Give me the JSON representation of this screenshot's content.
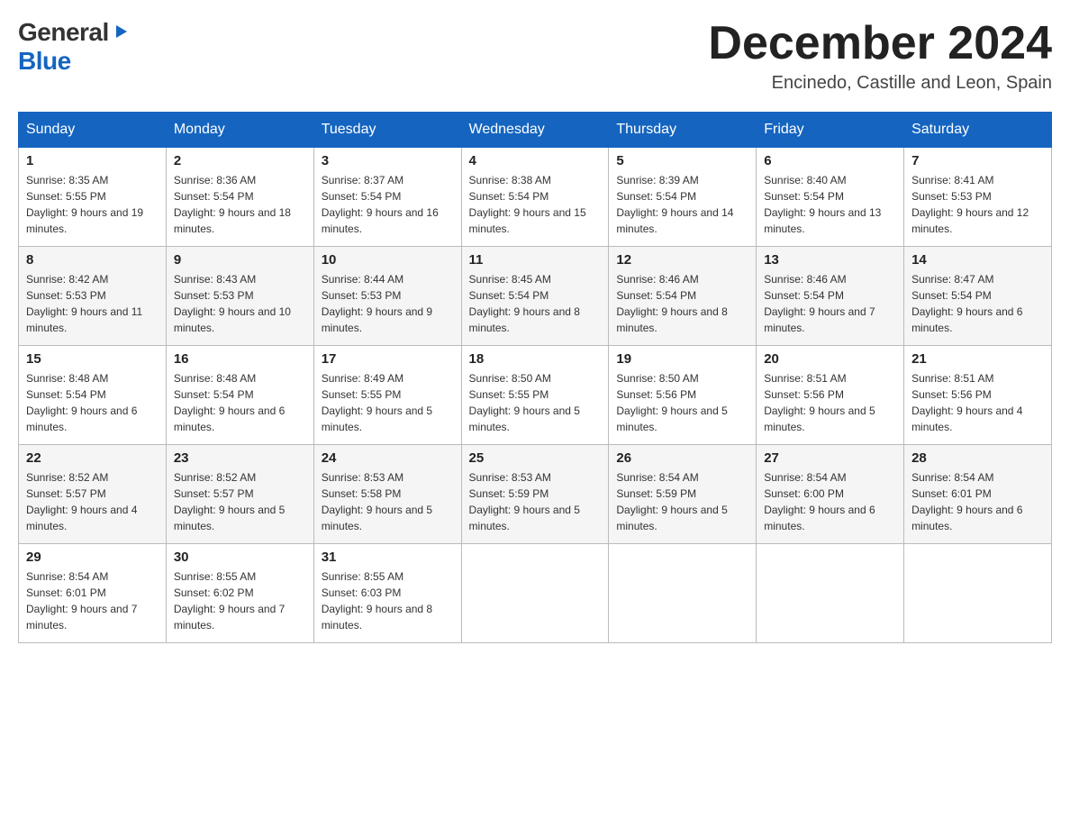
{
  "logo": {
    "general": "General",
    "blue": "Blue",
    "arrow": "▶"
  },
  "header": {
    "month_year": "December 2024",
    "location": "Encinedo, Castille and Leon, Spain"
  },
  "weekdays": [
    "Sunday",
    "Monday",
    "Tuesday",
    "Wednesday",
    "Thursday",
    "Friday",
    "Saturday"
  ],
  "weeks": [
    [
      {
        "day": "1",
        "sunrise": "8:35 AM",
        "sunset": "5:55 PM",
        "daylight": "9 hours and 19 minutes."
      },
      {
        "day": "2",
        "sunrise": "8:36 AM",
        "sunset": "5:54 PM",
        "daylight": "9 hours and 18 minutes."
      },
      {
        "day": "3",
        "sunrise": "8:37 AM",
        "sunset": "5:54 PM",
        "daylight": "9 hours and 16 minutes."
      },
      {
        "day": "4",
        "sunrise": "8:38 AM",
        "sunset": "5:54 PM",
        "daylight": "9 hours and 15 minutes."
      },
      {
        "day": "5",
        "sunrise": "8:39 AM",
        "sunset": "5:54 PM",
        "daylight": "9 hours and 14 minutes."
      },
      {
        "day": "6",
        "sunrise": "8:40 AM",
        "sunset": "5:54 PM",
        "daylight": "9 hours and 13 minutes."
      },
      {
        "day": "7",
        "sunrise": "8:41 AM",
        "sunset": "5:53 PM",
        "daylight": "9 hours and 12 minutes."
      }
    ],
    [
      {
        "day": "8",
        "sunrise": "8:42 AM",
        "sunset": "5:53 PM",
        "daylight": "9 hours and 11 minutes."
      },
      {
        "day": "9",
        "sunrise": "8:43 AM",
        "sunset": "5:53 PM",
        "daylight": "9 hours and 10 minutes."
      },
      {
        "day": "10",
        "sunrise": "8:44 AM",
        "sunset": "5:53 PM",
        "daylight": "9 hours and 9 minutes."
      },
      {
        "day": "11",
        "sunrise": "8:45 AM",
        "sunset": "5:54 PM",
        "daylight": "9 hours and 8 minutes."
      },
      {
        "day": "12",
        "sunrise": "8:46 AM",
        "sunset": "5:54 PM",
        "daylight": "9 hours and 8 minutes."
      },
      {
        "day": "13",
        "sunrise": "8:46 AM",
        "sunset": "5:54 PM",
        "daylight": "9 hours and 7 minutes."
      },
      {
        "day": "14",
        "sunrise": "8:47 AM",
        "sunset": "5:54 PM",
        "daylight": "9 hours and 6 minutes."
      }
    ],
    [
      {
        "day": "15",
        "sunrise": "8:48 AM",
        "sunset": "5:54 PM",
        "daylight": "9 hours and 6 minutes."
      },
      {
        "day": "16",
        "sunrise": "8:48 AM",
        "sunset": "5:54 PM",
        "daylight": "9 hours and 6 minutes."
      },
      {
        "day": "17",
        "sunrise": "8:49 AM",
        "sunset": "5:55 PM",
        "daylight": "9 hours and 5 minutes."
      },
      {
        "day": "18",
        "sunrise": "8:50 AM",
        "sunset": "5:55 PM",
        "daylight": "9 hours and 5 minutes."
      },
      {
        "day": "19",
        "sunrise": "8:50 AM",
        "sunset": "5:56 PM",
        "daylight": "9 hours and 5 minutes."
      },
      {
        "day": "20",
        "sunrise": "8:51 AM",
        "sunset": "5:56 PM",
        "daylight": "9 hours and 5 minutes."
      },
      {
        "day": "21",
        "sunrise": "8:51 AM",
        "sunset": "5:56 PM",
        "daylight": "9 hours and 4 minutes."
      }
    ],
    [
      {
        "day": "22",
        "sunrise": "8:52 AM",
        "sunset": "5:57 PM",
        "daylight": "9 hours and 4 minutes."
      },
      {
        "day": "23",
        "sunrise": "8:52 AM",
        "sunset": "5:57 PM",
        "daylight": "9 hours and 5 minutes."
      },
      {
        "day": "24",
        "sunrise": "8:53 AM",
        "sunset": "5:58 PM",
        "daylight": "9 hours and 5 minutes."
      },
      {
        "day": "25",
        "sunrise": "8:53 AM",
        "sunset": "5:59 PM",
        "daylight": "9 hours and 5 minutes."
      },
      {
        "day": "26",
        "sunrise": "8:54 AM",
        "sunset": "5:59 PM",
        "daylight": "9 hours and 5 minutes."
      },
      {
        "day": "27",
        "sunrise": "8:54 AM",
        "sunset": "6:00 PM",
        "daylight": "9 hours and 6 minutes."
      },
      {
        "day": "28",
        "sunrise": "8:54 AM",
        "sunset": "6:01 PM",
        "daylight": "9 hours and 6 minutes."
      }
    ],
    [
      {
        "day": "29",
        "sunrise": "8:54 AM",
        "sunset": "6:01 PM",
        "daylight": "9 hours and 7 minutes."
      },
      {
        "day": "30",
        "sunrise": "8:55 AM",
        "sunset": "6:02 PM",
        "daylight": "9 hours and 7 minutes."
      },
      {
        "day": "31",
        "sunrise": "8:55 AM",
        "sunset": "6:03 PM",
        "daylight": "9 hours and 8 minutes."
      },
      null,
      null,
      null,
      null
    ]
  ]
}
